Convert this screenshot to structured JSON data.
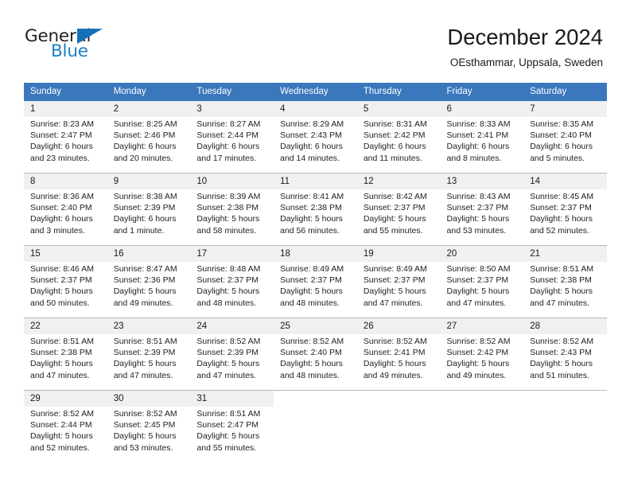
{
  "logo": {
    "word_top": "General",
    "word_bottom": "Blue",
    "triangle_color": "#1670b8",
    "blue_color": "#1d7ec4"
  },
  "header": {
    "title": "December 2024",
    "subtitle": "OEsthammar, Uppsala, Sweden"
  },
  "colors": {
    "header_row": "#3b77bc",
    "daynum_row": "#f0f0f0",
    "grid_line": "#b9b9b9"
  },
  "weekdays": [
    "Sunday",
    "Monday",
    "Tuesday",
    "Wednesday",
    "Thursday",
    "Friday",
    "Saturday"
  ],
  "weeks": [
    [
      {
        "day": "1",
        "sunrise": "Sunrise: 8:23 AM",
        "sunset": "Sunset: 2:47 PM",
        "daylight1": "Daylight: 6 hours",
        "daylight2": "and 23 minutes."
      },
      {
        "day": "2",
        "sunrise": "Sunrise: 8:25 AM",
        "sunset": "Sunset: 2:46 PM",
        "daylight1": "Daylight: 6 hours",
        "daylight2": "and 20 minutes."
      },
      {
        "day": "3",
        "sunrise": "Sunrise: 8:27 AM",
        "sunset": "Sunset: 2:44 PM",
        "daylight1": "Daylight: 6 hours",
        "daylight2": "and 17 minutes."
      },
      {
        "day": "4",
        "sunrise": "Sunrise: 8:29 AM",
        "sunset": "Sunset: 2:43 PM",
        "daylight1": "Daylight: 6 hours",
        "daylight2": "and 14 minutes."
      },
      {
        "day": "5",
        "sunrise": "Sunrise: 8:31 AM",
        "sunset": "Sunset: 2:42 PM",
        "daylight1": "Daylight: 6 hours",
        "daylight2": "and 11 minutes."
      },
      {
        "day": "6",
        "sunrise": "Sunrise: 8:33 AM",
        "sunset": "Sunset: 2:41 PM",
        "daylight1": "Daylight: 6 hours",
        "daylight2": "and 8 minutes."
      },
      {
        "day": "7",
        "sunrise": "Sunrise: 8:35 AM",
        "sunset": "Sunset: 2:40 PM",
        "daylight1": "Daylight: 6 hours",
        "daylight2": "and 5 minutes."
      }
    ],
    [
      {
        "day": "8",
        "sunrise": "Sunrise: 8:36 AM",
        "sunset": "Sunset: 2:40 PM",
        "daylight1": "Daylight: 6 hours",
        "daylight2": "and 3 minutes."
      },
      {
        "day": "9",
        "sunrise": "Sunrise: 8:38 AM",
        "sunset": "Sunset: 2:39 PM",
        "daylight1": "Daylight: 6 hours",
        "daylight2": "and 1 minute."
      },
      {
        "day": "10",
        "sunrise": "Sunrise: 8:39 AM",
        "sunset": "Sunset: 2:38 PM",
        "daylight1": "Daylight: 5 hours",
        "daylight2": "and 58 minutes."
      },
      {
        "day": "11",
        "sunrise": "Sunrise: 8:41 AM",
        "sunset": "Sunset: 2:38 PM",
        "daylight1": "Daylight: 5 hours",
        "daylight2": "and 56 minutes."
      },
      {
        "day": "12",
        "sunrise": "Sunrise: 8:42 AM",
        "sunset": "Sunset: 2:37 PM",
        "daylight1": "Daylight: 5 hours",
        "daylight2": "and 55 minutes."
      },
      {
        "day": "13",
        "sunrise": "Sunrise: 8:43 AM",
        "sunset": "Sunset: 2:37 PM",
        "daylight1": "Daylight: 5 hours",
        "daylight2": "and 53 minutes."
      },
      {
        "day": "14",
        "sunrise": "Sunrise: 8:45 AM",
        "sunset": "Sunset: 2:37 PM",
        "daylight1": "Daylight: 5 hours",
        "daylight2": "and 52 minutes."
      }
    ],
    [
      {
        "day": "15",
        "sunrise": "Sunrise: 8:46 AM",
        "sunset": "Sunset: 2:37 PM",
        "daylight1": "Daylight: 5 hours",
        "daylight2": "and 50 minutes."
      },
      {
        "day": "16",
        "sunrise": "Sunrise: 8:47 AM",
        "sunset": "Sunset: 2:36 PM",
        "daylight1": "Daylight: 5 hours",
        "daylight2": "and 49 minutes."
      },
      {
        "day": "17",
        "sunrise": "Sunrise: 8:48 AM",
        "sunset": "Sunset: 2:37 PM",
        "daylight1": "Daylight: 5 hours",
        "daylight2": "and 48 minutes."
      },
      {
        "day": "18",
        "sunrise": "Sunrise: 8:49 AM",
        "sunset": "Sunset: 2:37 PM",
        "daylight1": "Daylight: 5 hours",
        "daylight2": "and 48 minutes."
      },
      {
        "day": "19",
        "sunrise": "Sunrise: 8:49 AM",
        "sunset": "Sunset: 2:37 PM",
        "daylight1": "Daylight: 5 hours",
        "daylight2": "and 47 minutes."
      },
      {
        "day": "20",
        "sunrise": "Sunrise: 8:50 AM",
        "sunset": "Sunset: 2:37 PM",
        "daylight1": "Daylight: 5 hours",
        "daylight2": "and 47 minutes."
      },
      {
        "day": "21",
        "sunrise": "Sunrise: 8:51 AM",
        "sunset": "Sunset: 2:38 PM",
        "daylight1": "Daylight: 5 hours",
        "daylight2": "and 47 minutes."
      }
    ],
    [
      {
        "day": "22",
        "sunrise": "Sunrise: 8:51 AM",
        "sunset": "Sunset: 2:38 PM",
        "daylight1": "Daylight: 5 hours",
        "daylight2": "and 47 minutes."
      },
      {
        "day": "23",
        "sunrise": "Sunrise: 8:51 AM",
        "sunset": "Sunset: 2:39 PM",
        "daylight1": "Daylight: 5 hours",
        "daylight2": "and 47 minutes."
      },
      {
        "day": "24",
        "sunrise": "Sunrise: 8:52 AM",
        "sunset": "Sunset: 2:39 PM",
        "daylight1": "Daylight: 5 hours",
        "daylight2": "and 47 minutes."
      },
      {
        "day": "25",
        "sunrise": "Sunrise: 8:52 AM",
        "sunset": "Sunset: 2:40 PM",
        "daylight1": "Daylight: 5 hours",
        "daylight2": "and 48 minutes."
      },
      {
        "day": "26",
        "sunrise": "Sunrise: 8:52 AM",
        "sunset": "Sunset: 2:41 PM",
        "daylight1": "Daylight: 5 hours",
        "daylight2": "and 49 minutes."
      },
      {
        "day": "27",
        "sunrise": "Sunrise: 8:52 AM",
        "sunset": "Sunset: 2:42 PM",
        "daylight1": "Daylight: 5 hours",
        "daylight2": "and 49 minutes."
      },
      {
        "day": "28",
        "sunrise": "Sunrise: 8:52 AM",
        "sunset": "Sunset: 2:43 PM",
        "daylight1": "Daylight: 5 hours",
        "daylight2": "and 51 minutes."
      }
    ],
    [
      {
        "day": "29",
        "sunrise": "Sunrise: 8:52 AM",
        "sunset": "Sunset: 2:44 PM",
        "daylight1": "Daylight: 5 hours",
        "daylight2": "and 52 minutes."
      },
      {
        "day": "30",
        "sunrise": "Sunrise: 8:52 AM",
        "sunset": "Sunset: 2:45 PM",
        "daylight1": "Daylight: 5 hours",
        "daylight2": "and 53 minutes."
      },
      {
        "day": "31",
        "sunrise": "Sunrise: 8:51 AM",
        "sunset": "Sunset: 2:47 PM",
        "daylight1": "Daylight: 5 hours",
        "daylight2": "and 55 minutes."
      },
      null,
      null,
      null,
      null
    ]
  ]
}
